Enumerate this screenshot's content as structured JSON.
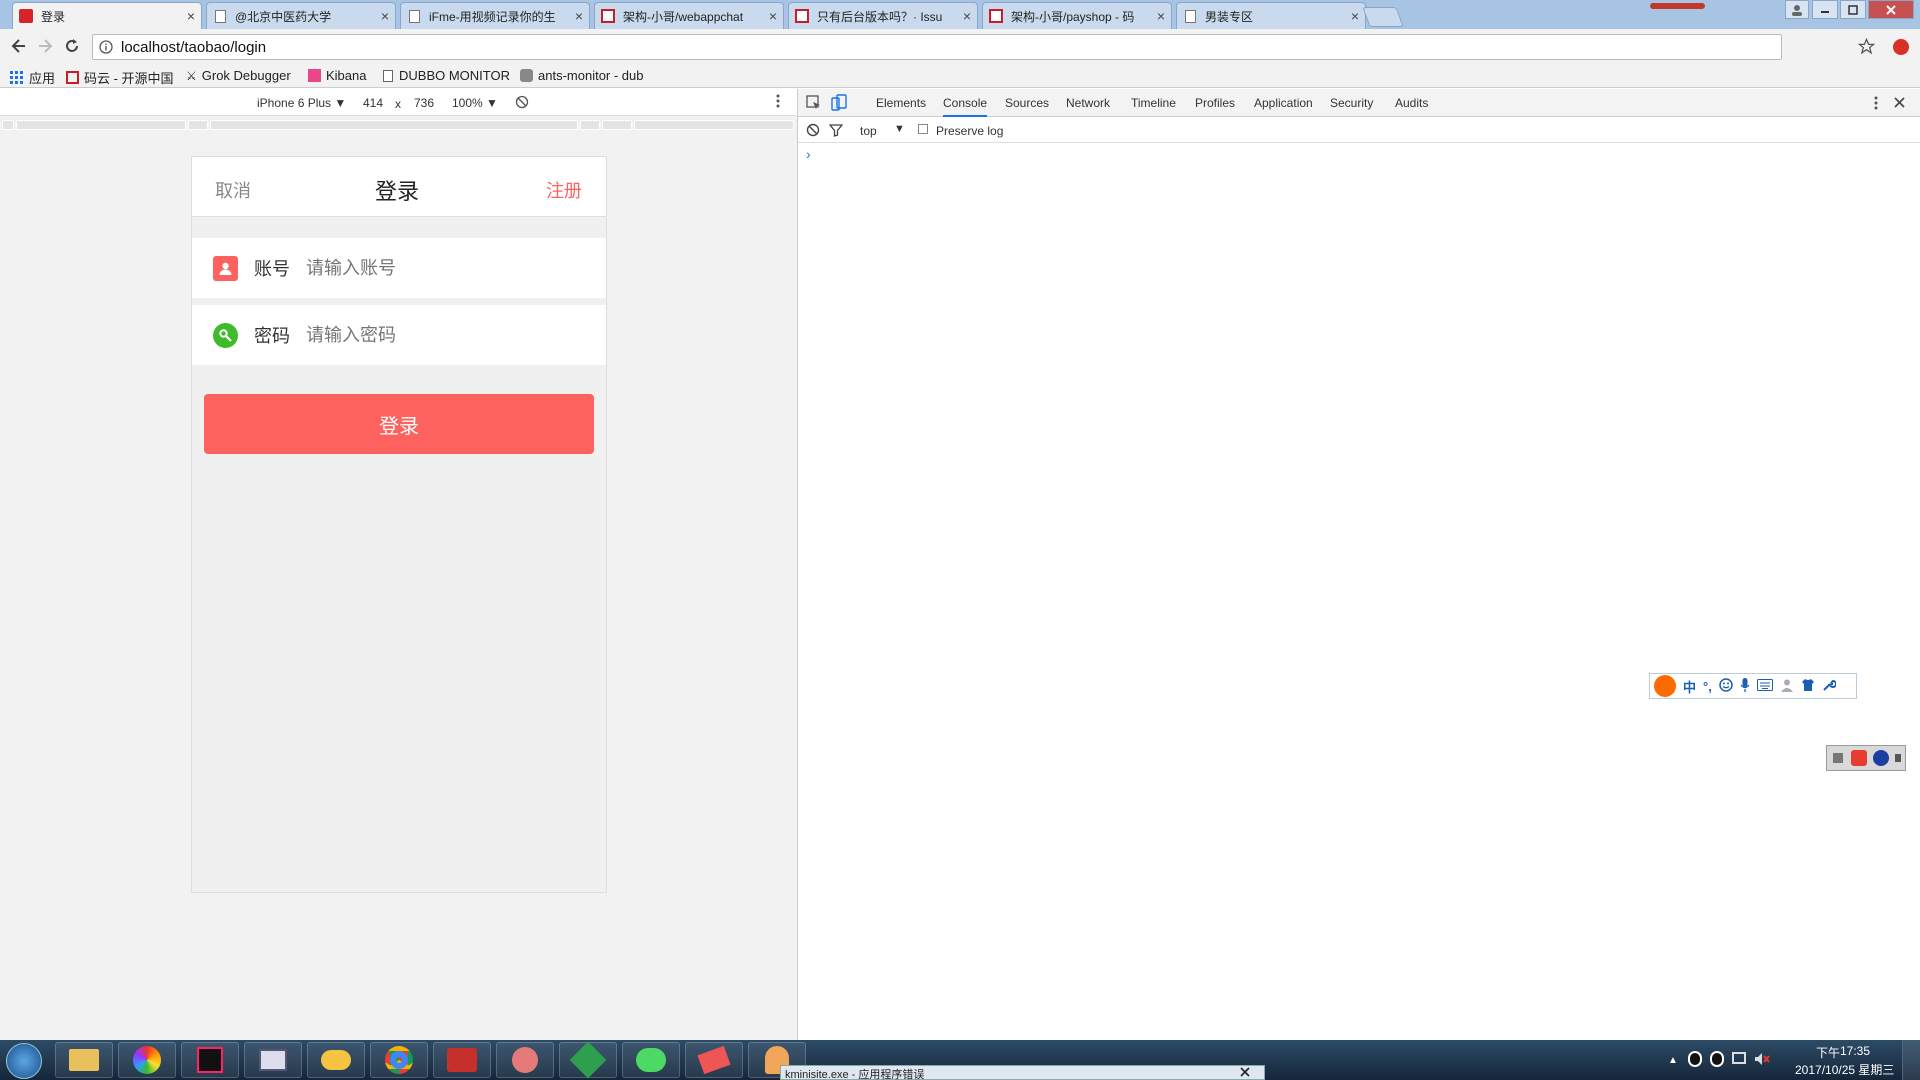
{
  "browser": {
    "tabs": [
      {
        "title": "登录",
        "favicon": "red-logo-icon",
        "active": true
      },
      {
        "title": "@北京中医药大学",
        "favicon": "doc-icon",
        "active": false
      },
      {
        "title": "iFme-用视频记录你的生",
        "favicon": "doc-icon",
        "active": false
      },
      {
        "title": "架构-小哥/webappchat",
        "favicon": "git-icon",
        "active": false
      },
      {
        "title": "只有后台版本吗？· Issu",
        "favicon": "git-icon",
        "active": false
      },
      {
        "title": "架构-小哥/payshop - 码",
        "favicon": "git-icon",
        "active": false
      },
      {
        "title": "男装专区",
        "favicon": "doc-icon",
        "active": false
      }
    ],
    "tab_close": "×",
    "url": "localhost/taobao/login",
    "bookmarks": [
      "应用",
      "码云 - 开源中国",
      "Grok Debugger",
      "Kibana",
      "DUBBO MONITOR",
      "ants-monitor - dub"
    ]
  },
  "device_toolbar": {
    "device": "iPhone 6 Plus ▼",
    "width": "414",
    "x": "x",
    "height": "736",
    "zoom": "100% ▼"
  },
  "devtools": {
    "tabs": [
      "Elements",
      "Console",
      "Sources",
      "Network",
      "Timeline",
      "Profiles",
      "Application",
      "Security",
      "Audits"
    ],
    "active_tab": "Console",
    "context": "top",
    "context_arrow": "▼",
    "preserve_log": "Preserve log",
    "prompt": "›"
  },
  "app": {
    "header": {
      "cancel": "取消",
      "title": "登录",
      "register": "注册"
    },
    "account_label": "账号",
    "account_placeholder": "请输入账号",
    "password_label": "密码",
    "password_placeholder": "请输入密码",
    "login_button": "登录"
  },
  "ime": {
    "lang": "中"
  },
  "taskbar": {
    "time": "17:35",
    "ampm": "下午",
    "date": "2017/10/25 星期三",
    "notification": "kminisite.exe - 应用程序错误"
  },
  "colors": {
    "accent": "#fe625f",
    "account_icon": "#fe625f",
    "password_icon": "#3dbb2a"
  }
}
